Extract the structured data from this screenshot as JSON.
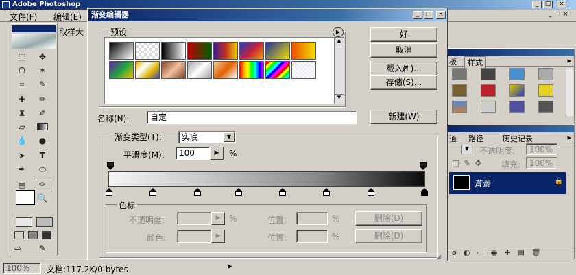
{
  "app": {
    "title": "Adobe Photoshop"
  },
  "menu": {
    "file": "文件(F)",
    "edit": "编辑(E)",
    "sample_fragment": "取样大"
  },
  "dialog": {
    "title": "渐变编辑器",
    "presets_label": "预设",
    "ok": "好",
    "cancel": "取消",
    "load": "载入(L)...",
    "save": "存储(S)...",
    "name_label": "名称(N):",
    "name_value": "自定",
    "new_button": "新建(W)",
    "gradient_type_label": "渐变类型(T):",
    "gradient_type_value": "实底",
    "smoothness_label": "平滑度(M):",
    "smoothness_value": "100",
    "smoothness_unit": "%",
    "stops_group": "色标",
    "opacity_label": "不透明度:",
    "opacity_unit": "%",
    "location_label": "位置:",
    "location_unit": "%",
    "delete_label": "删除(D)",
    "color_label": "颜色:"
  },
  "preset_swatches": [
    "linear-gradient(135deg,#000,#fff)",
    "repeating-conic-gradient(#ddd 0 25%,#fff 0 50%) 0 0/8px 8px",
    "linear-gradient(90deg,#000,#fff)",
    "linear-gradient(90deg,#c00000,#006000)",
    "linear-gradient(90deg,#3b1b8f,#c03020,#f0d000)",
    "linear-gradient(135deg,#2040c0,#c02040,#f0a000)",
    "linear-gradient(135deg,#2030a0,#f0e000)",
    "linear-gradient(90deg,#f05000,#f0e000)",
    "linear-gradient(135deg,#6020a0,#20a040,#f0c000)",
    "linear-gradient(135deg,#e0b000,#fff,#e0b000,#3050c0)",
    "linear-gradient(135deg,#804020,#f0c0a0,#804020)",
    "linear-gradient(135deg,#a0a0a0,#fff,#a0a0a0)",
    "linear-gradient(135deg,#f0d0a0,#e06000,#fff)",
    "linear-gradient(90deg,red,orange,yellow,lime,cyan,blue,magenta)",
    "repeating-linear-gradient(135deg,red 0 4px,yellow 4px 8px,lime 8px 12px,cyan 12px 16px,blue 16px 20px,magenta 20px 24px)",
    "repeating-conic-gradient(#e8e8ff 0 25%,#fff 0 50%) 0 0/6px 6px"
  ],
  "panels": {
    "swatches_tab": "板",
    "styles_tab": "样式",
    "paths_tab": "路径",
    "history_tab": "历史记录",
    "opacity_label": "不透明度:",
    "opacity_value": "100%",
    "fill_label": "填充:",
    "fill_value": "100%",
    "layer_name": "背景"
  },
  "status": {
    "zoom": "100%",
    "doc": "文档:117.2K/0 bytes"
  }
}
